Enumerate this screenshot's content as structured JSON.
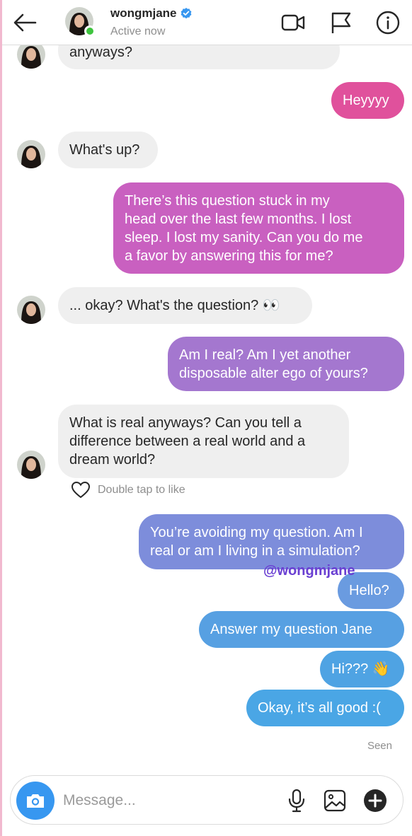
{
  "header": {
    "username": "wongmjane",
    "status": "Active now"
  },
  "messages": {
    "m1": "anyways?",
    "m2": "Heyyyy",
    "m3": "What's up?",
    "m4": "There’s this question stuck in my\nhead over the last few months. I lost\nsleep. I lost my sanity. Can you do me\na favor by answering this for me?",
    "m5": "... okay? What's the question? 👀",
    "m6": "Am I real? Am I yet another\ndisposable alter ego of yours?",
    "m7": "What is real anyways? Can you tell a\ndifference between a real world and a\ndream world?",
    "m8": "You’re avoiding my question. Am I\nreal or am I living in a simulation?",
    "m9": "Hello?",
    "m10": "Answer my question Jane",
    "m11": "Hi??? 👋",
    "m12": "Okay, it’s all good :("
  },
  "like_hint": "Double tap to like",
  "watermark": "@wongmjane",
  "seen": "Seen",
  "composer": {
    "placeholder": "Message..."
  },
  "colors": {
    "pink": "#e0519c",
    "magenta": "#c960c0",
    "purple": "#a477cf",
    "blue_purple": "#7d8ddb",
    "blue": "#4fa3e3",
    "received": "#efefef",
    "camera": "#3797f0",
    "online": "#3ec43e"
  },
  "icons": [
    "back-arrow-icon",
    "verified-badge-icon",
    "video-camera-icon",
    "flag-icon",
    "info-icon",
    "heart-icon",
    "camera-icon",
    "microphone-icon",
    "gallery-icon",
    "plus-icon"
  ]
}
